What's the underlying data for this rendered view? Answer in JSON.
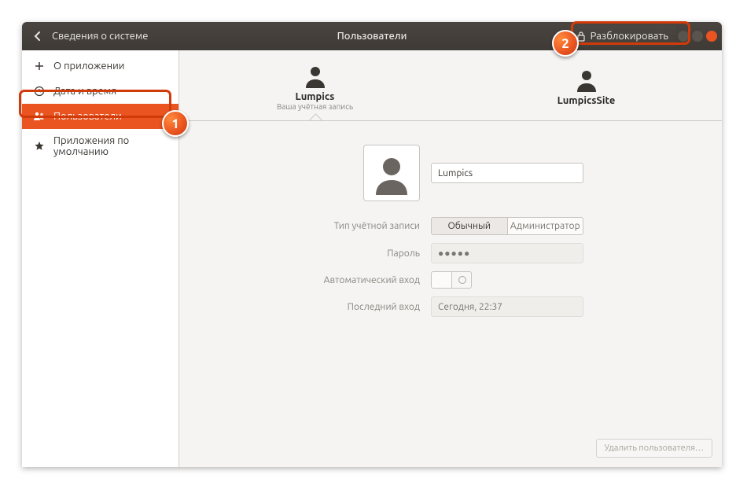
{
  "header": {
    "back_title": "Сведения о системе",
    "center_title": "Пользователи",
    "unlock_label": "Разблокировать"
  },
  "sidebar": {
    "items": [
      {
        "label": "О приложении",
        "icon": "plus"
      },
      {
        "label": "Дата и время",
        "icon": "clock"
      },
      {
        "label": "Пользователи",
        "icon": "users",
        "selected": true
      },
      {
        "label": "Приложения по умолчанию",
        "icon": "star"
      }
    ]
  },
  "users": [
    {
      "name": "Lumpics",
      "subtitle": "Ваша учётная запись",
      "active": true
    },
    {
      "name": "LumpicsSite",
      "subtitle": "",
      "active": false
    }
  ],
  "details": {
    "name_value": "Lumpics",
    "type_label": "Тип учётной записи",
    "type_options": [
      "Обычный",
      "Администратор"
    ],
    "type_active": 0,
    "password_label": "Пароль",
    "password_value": "●●●●●",
    "autologin_label": "Автоматический вход",
    "autologin_on": false,
    "lastlogin_label": "Последний вход",
    "lastlogin_value": "Сегодня, 22:37",
    "delete_label": "Удалить пользователя…"
  },
  "callouts": {
    "one": "1",
    "two": "2"
  }
}
